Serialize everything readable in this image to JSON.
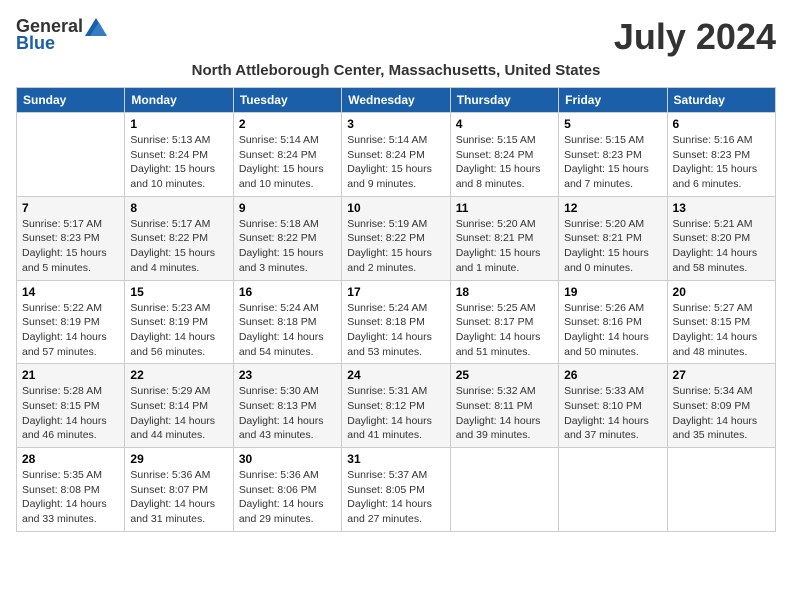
{
  "header": {
    "logo_general": "General",
    "logo_blue": "Blue",
    "month_title": "July 2024",
    "location": "North Attleborough Center, Massachusetts, United States"
  },
  "weekdays": [
    "Sunday",
    "Monday",
    "Tuesday",
    "Wednesday",
    "Thursday",
    "Friday",
    "Saturday"
  ],
  "weeks": [
    [
      {
        "day": "",
        "info": ""
      },
      {
        "day": "1",
        "info": "Sunrise: 5:13 AM\nSunset: 8:24 PM\nDaylight: 15 hours\nand 10 minutes."
      },
      {
        "day": "2",
        "info": "Sunrise: 5:14 AM\nSunset: 8:24 PM\nDaylight: 15 hours\nand 10 minutes."
      },
      {
        "day": "3",
        "info": "Sunrise: 5:14 AM\nSunset: 8:24 PM\nDaylight: 15 hours\nand 9 minutes."
      },
      {
        "day": "4",
        "info": "Sunrise: 5:15 AM\nSunset: 8:24 PM\nDaylight: 15 hours\nand 8 minutes."
      },
      {
        "day": "5",
        "info": "Sunrise: 5:15 AM\nSunset: 8:23 PM\nDaylight: 15 hours\nand 7 minutes."
      },
      {
        "day": "6",
        "info": "Sunrise: 5:16 AM\nSunset: 8:23 PM\nDaylight: 15 hours\nand 6 minutes."
      }
    ],
    [
      {
        "day": "7",
        "info": "Sunrise: 5:17 AM\nSunset: 8:23 PM\nDaylight: 15 hours\nand 5 minutes."
      },
      {
        "day": "8",
        "info": "Sunrise: 5:17 AM\nSunset: 8:22 PM\nDaylight: 15 hours\nand 4 minutes."
      },
      {
        "day": "9",
        "info": "Sunrise: 5:18 AM\nSunset: 8:22 PM\nDaylight: 15 hours\nand 3 minutes."
      },
      {
        "day": "10",
        "info": "Sunrise: 5:19 AM\nSunset: 8:22 PM\nDaylight: 15 hours\nand 2 minutes."
      },
      {
        "day": "11",
        "info": "Sunrise: 5:20 AM\nSunset: 8:21 PM\nDaylight: 15 hours\nand 1 minute."
      },
      {
        "day": "12",
        "info": "Sunrise: 5:20 AM\nSunset: 8:21 PM\nDaylight: 15 hours\nand 0 minutes."
      },
      {
        "day": "13",
        "info": "Sunrise: 5:21 AM\nSunset: 8:20 PM\nDaylight: 14 hours\nand 58 minutes."
      }
    ],
    [
      {
        "day": "14",
        "info": "Sunrise: 5:22 AM\nSunset: 8:19 PM\nDaylight: 14 hours\nand 57 minutes."
      },
      {
        "day": "15",
        "info": "Sunrise: 5:23 AM\nSunset: 8:19 PM\nDaylight: 14 hours\nand 56 minutes."
      },
      {
        "day": "16",
        "info": "Sunrise: 5:24 AM\nSunset: 8:18 PM\nDaylight: 14 hours\nand 54 minutes."
      },
      {
        "day": "17",
        "info": "Sunrise: 5:24 AM\nSunset: 8:18 PM\nDaylight: 14 hours\nand 53 minutes."
      },
      {
        "day": "18",
        "info": "Sunrise: 5:25 AM\nSunset: 8:17 PM\nDaylight: 14 hours\nand 51 minutes."
      },
      {
        "day": "19",
        "info": "Sunrise: 5:26 AM\nSunset: 8:16 PM\nDaylight: 14 hours\nand 50 minutes."
      },
      {
        "day": "20",
        "info": "Sunrise: 5:27 AM\nSunset: 8:15 PM\nDaylight: 14 hours\nand 48 minutes."
      }
    ],
    [
      {
        "day": "21",
        "info": "Sunrise: 5:28 AM\nSunset: 8:15 PM\nDaylight: 14 hours\nand 46 minutes."
      },
      {
        "day": "22",
        "info": "Sunrise: 5:29 AM\nSunset: 8:14 PM\nDaylight: 14 hours\nand 44 minutes."
      },
      {
        "day": "23",
        "info": "Sunrise: 5:30 AM\nSunset: 8:13 PM\nDaylight: 14 hours\nand 43 minutes."
      },
      {
        "day": "24",
        "info": "Sunrise: 5:31 AM\nSunset: 8:12 PM\nDaylight: 14 hours\nand 41 minutes."
      },
      {
        "day": "25",
        "info": "Sunrise: 5:32 AM\nSunset: 8:11 PM\nDaylight: 14 hours\nand 39 minutes."
      },
      {
        "day": "26",
        "info": "Sunrise: 5:33 AM\nSunset: 8:10 PM\nDaylight: 14 hours\nand 37 minutes."
      },
      {
        "day": "27",
        "info": "Sunrise: 5:34 AM\nSunset: 8:09 PM\nDaylight: 14 hours\nand 35 minutes."
      }
    ],
    [
      {
        "day": "28",
        "info": "Sunrise: 5:35 AM\nSunset: 8:08 PM\nDaylight: 14 hours\nand 33 minutes."
      },
      {
        "day": "29",
        "info": "Sunrise: 5:36 AM\nSunset: 8:07 PM\nDaylight: 14 hours\nand 31 minutes."
      },
      {
        "day": "30",
        "info": "Sunrise: 5:36 AM\nSunset: 8:06 PM\nDaylight: 14 hours\nand 29 minutes."
      },
      {
        "day": "31",
        "info": "Sunrise: 5:37 AM\nSunset: 8:05 PM\nDaylight: 14 hours\nand 27 minutes."
      },
      {
        "day": "",
        "info": ""
      },
      {
        "day": "",
        "info": ""
      },
      {
        "day": "",
        "info": ""
      }
    ]
  ]
}
